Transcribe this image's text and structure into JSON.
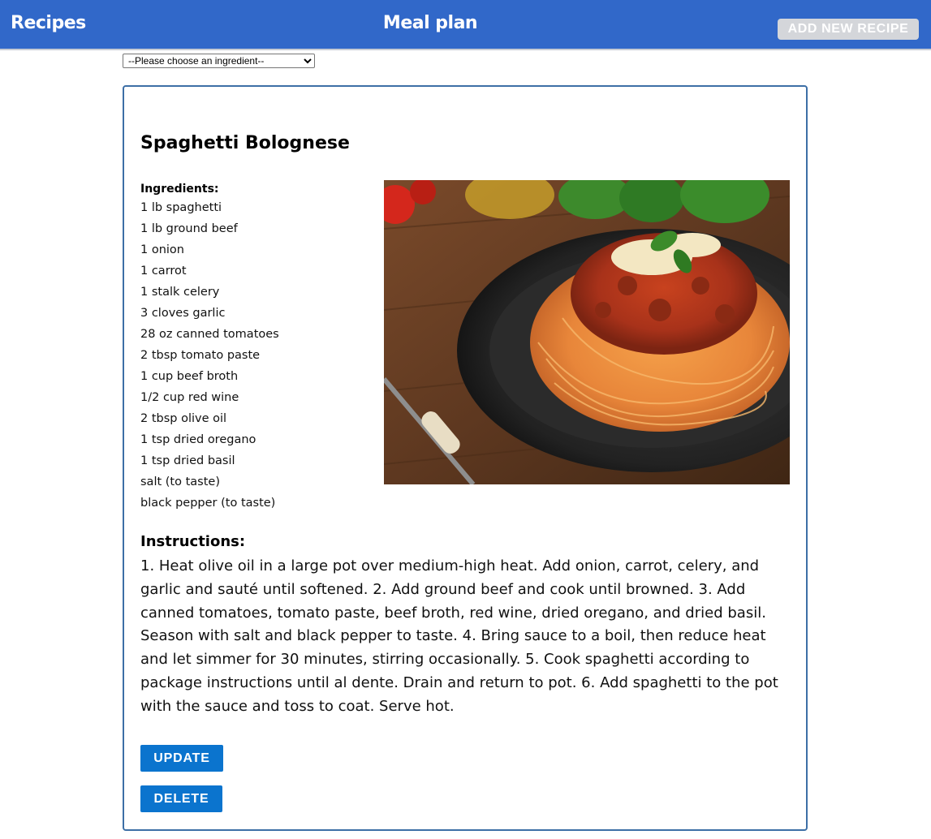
{
  "nav": {
    "brand": "Recipes",
    "title": "Meal plan",
    "add_button": "ADD NEW RECIPE"
  },
  "filter": {
    "selected": "--Please choose an ingredient--"
  },
  "recipe": {
    "title": "Spaghetti Bolognese",
    "ingredients_heading": "Ingredients:",
    "ingredients": [
      "1 lb spaghetti",
      "1 lb ground beef",
      "1 onion",
      "1 carrot",
      "1 stalk celery",
      "3 cloves garlic",
      "28 oz canned tomatoes",
      "2 tbsp tomato paste",
      "1 cup beef broth",
      "1/2 cup red wine",
      "2 tbsp olive oil",
      "1 tsp dried oregano",
      "1 tsp dried basil",
      "salt (to taste)",
      "black pepper (to taste)"
    ],
    "instructions_heading": "Instructions:",
    "instructions": "1. Heat olive oil in a large pot over medium-high heat. Add onion, carrot, celery, and garlic and sauté until softened. 2. Add ground beef and cook until browned. 3. Add canned tomatoes, tomato paste, beef broth, red wine, dried oregano, and dried basil. Season with salt and black pepper to taste. 4. Bring sauce to a boil, then reduce heat and let simmer for 30 minutes, stirring occasionally. 5. Cook spaghetti according to package instructions until al dente. Drain and return to pot. 6. Add spaghetti to the pot with the sauce and toss to coat. Serve hot.",
    "update_button": "UPDATE",
    "delete_button": "DELETE"
  },
  "colors": {
    "header_bg": "#3168c9",
    "button_bg": "#0b74ce",
    "card_border": "#3d6fa6"
  }
}
